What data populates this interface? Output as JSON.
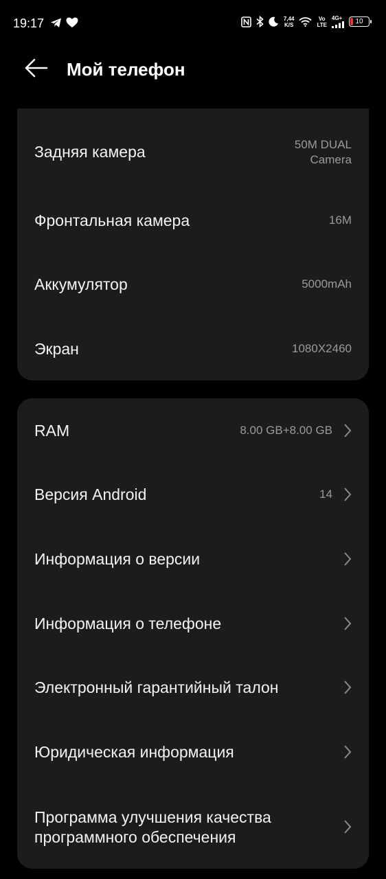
{
  "status_bar": {
    "time": "19:17",
    "net_speed_top": "7,44",
    "net_speed_bottom": "K/S",
    "volte_top": "Vo",
    "volte_bottom": "LTE",
    "network_type": "4G+",
    "battery_level": "10",
    "battery_color": "#e53935"
  },
  "header": {
    "title": "Мой телефон"
  },
  "hardware": [
    {
      "label": "Задняя камера",
      "value_line1": "50M DUAL",
      "value_line2": "Camera"
    },
    {
      "label": "Фронтальная камера",
      "value": "16M"
    },
    {
      "label": "Аккумулятор",
      "value": "5000mAh"
    },
    {
      "label": "Экран",
      "value": "1080X2460"
    }
  ],
  "system": [
    {
      "label": "RAM",
      "value": "8.00 GB+8.00 GB"
    },
    {
      "label": "Версия Android",
      "value": "14"
    },
    {
      "label": "Информация о версии"
    },
    {
      "label": "Информация о телефоне"
    },
    {
      "label": "Электронный гарантийный талон"
    },
    {
      "label": "Юридическая информация"
    },
    {
      "label_line1": "Программа улучшения качества",
      "label_line2": "программного обеспечения"
    }
  ],
  "colors": {
    "background": "#000000",
    "card": "#1c1c1c",
    "secondary_text": "#9a9a9a"
  }
}
